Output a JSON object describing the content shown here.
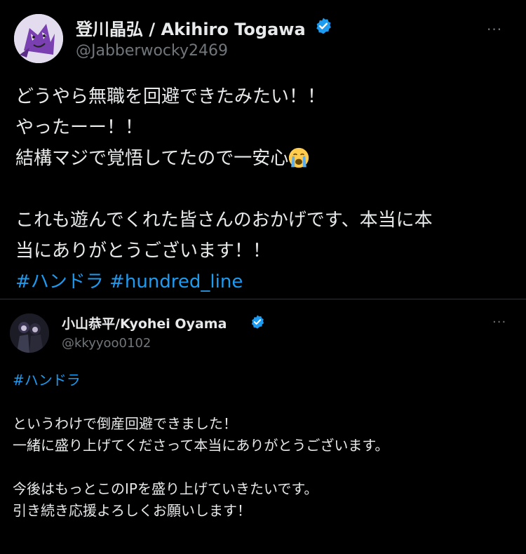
{
  "tweet1": {
    "display_name": "登川晶弘 / Akihiro Togawa",
    "handle": "@Jabberwocky2469",
    "more": "···",
    "lines": [
      "どうやら無職を回避できたみたい！！",
      "やったーー！！",
      "結構マジで覚悟してたので一安心"
    ],
    "lines_after_gap": [
      "これも遊んでくれた皆さんのおかげです、本当に本",
      "当にありがとうございます！！"
    ],
    "hashtags": "#ハンドラ #hundred_line",
    "emoji": "loudly-crying-face"
  },
  "tweet2": {
    "display_name": "小山恭平/Kyohei Oyama",
    "handle": "@kkyyoo0102",
    "more": "···",
    "hashtag": "#ハンドラ",
    "para1": [
      "というわけで倒産回避できました！",
      "一緒に盛り上げてくださって本当にありがとうございます。"
    ],
    "para2": [
      "今後はもっとこのIPを盛り上げていきたいです。",
      "引き続き応援よろしくお願いします！"
    ]
  },
  "colors": {
    "background": "#000000",
    "text": "#e7e9ea",
    "secondary": "#71767b",
    "link": "#1d9bf0",
    "verified": "#1d9bf0",
    "divider": "#2f3336"
  }
}
